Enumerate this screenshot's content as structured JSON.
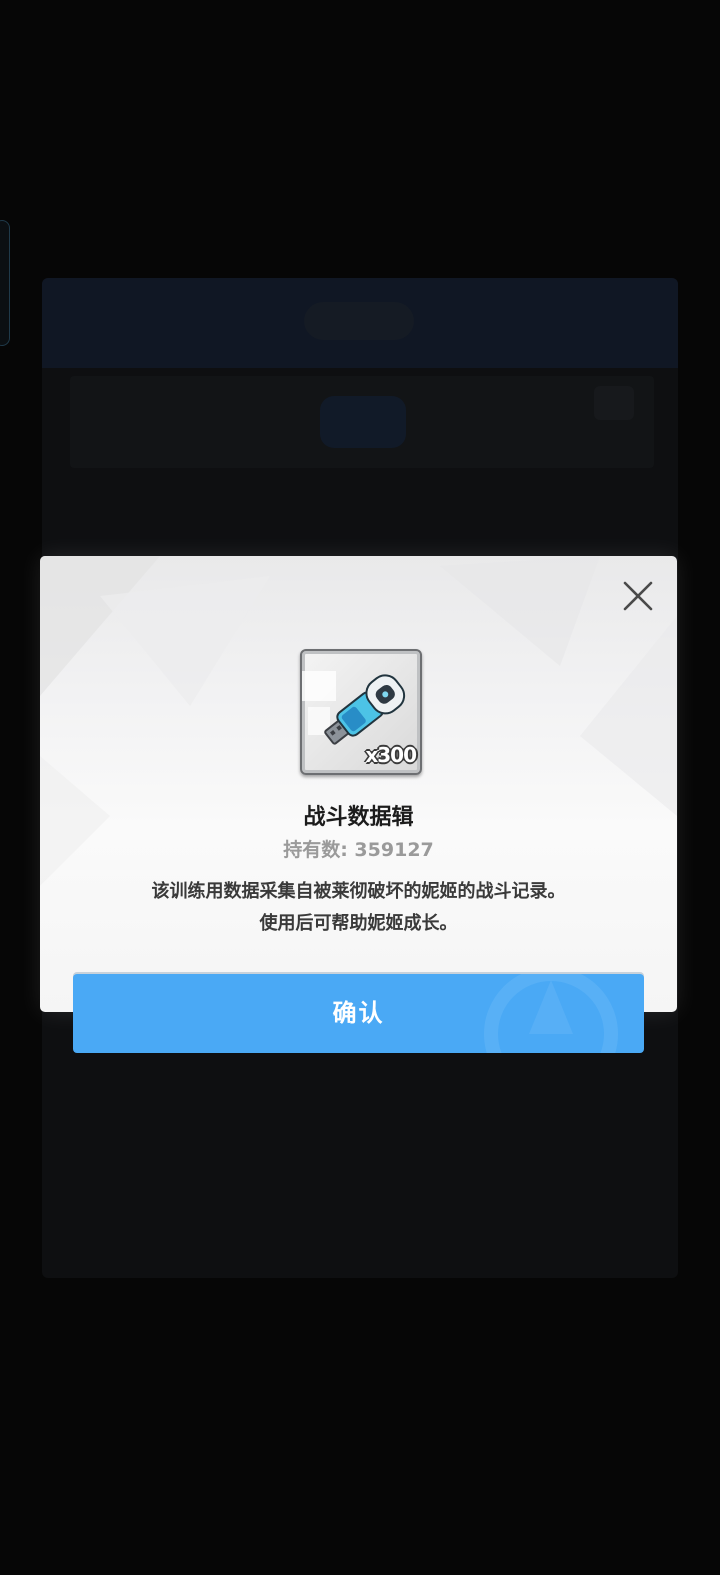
{
  "dialog": {
    "item": {
      "name": "战斗数据辑",
      "quantity_badge": "x300",
      "icon": "usb-data-drive-icon"
    },
    "owned_text": "持有数: 359127",
    "description_lines": [
      "该训练用数据采集自被莱彻破坏的妮姬的战斗记录。",
      "使用后可帮助妮姬成长。"
    ],
    "close_icon": "close-icon",
    "confirm_label": "确认"
  },
  "colors": {
    "confirm_button": "#4aa9f5",
    "dialog_background": "#f5f5f5",
    "backdrop": "#060606"
  }
}
